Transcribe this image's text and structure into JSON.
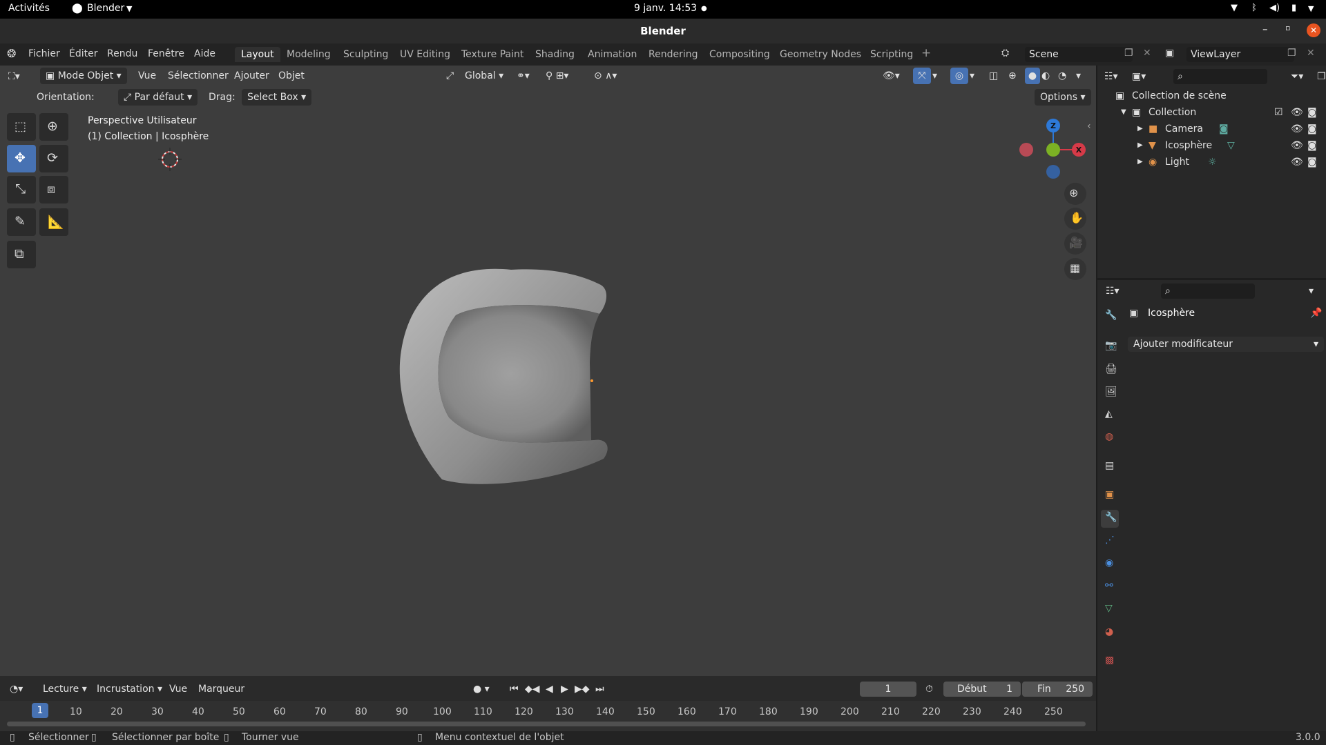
{
  "system": {
    "activities": "Activités",
    "app_menu": "Blender",
    "clock": "9 janv.  14:53"
  },
  "window": {
    "title": "Blender"
  },
  "menu": {
    "items": [
      "Fichier",
      "Éditer",
      "Rendu",
      "Fenêtre",
      "Aide"
    ]
  },
  "workspaces": {
    "tabs": [
      "Layout",
      "Modeling",
      "Sculpting",
      "UV Editing",
      "Texture Paint",
      "Shading",
      "Animation",
      "Rendering",
      "Compositing",
      "Geometry Nodes",
      "Scripting"
    ],
    "active": "Layout"
  },
  "scene": {
    "name": "Scene"
  },
  "view_layer": {
    "name": "ViewLayer"
  },
  "viewport_header": {
    "mode": "Mode Objet",
    "menus": [
      "Vue",
      "Sélectionner",
      "Ajouter",
      "Objet"
    ],
    "transform_orientation": "Global"
  },
  "tool_header": {
    "orientation_label": "Orientation:",
    "orientation_value": "Par défaut",
    "drag_label": "Drag:",
    "drag_value": "Select Box",
    "options_label": "Options"
  },
  "viewport": {
    "perspective_label": "Perspective Utilisateur",
    "collection_label": "(1) Collection | Icosphère",
    "object_color": "#8a8a8a",
    "background_color": "#3d3d3d"
  },
  "gizmo": {
    "x_label": "X",
    "y_label": "Y",
    "z_label": "Z",
    "x_color": "#d63a48",
    "y_color": "#7cb124",
    "z_color": "#2d79d8"
  },
  "outliner": {
    "scene_collection": "Collection de scène",
    "items": [
      {
        "name": "Collection",
        "level": 1
      },
      {
        "name": "Camera",
        "level": 2
      },
      {
        "name": "Icosphère",
        "level": 2
      },
      {
        "name": "Light",
        "level": 2
      }
    ]
  },
  "properties": {
    "object_name": "Icosphère",
    "add_modifier": "Ajouter modificateur"
  },
  "timeline": {
    "menus": [
      "Lecture",
      "Incrustation",
      "Vue",
      "Marqueur"
    ],
    "current_frame": "1",
    "start_label": "Début",
    "start_value": "1",
    "end_label": "Fin",
    "end_value": "250",
    "ruler": [
      "1",
      "10",
      "20",
      "30",
      "40",
      "50",
      "60",
      "70",
      "80",
      "90",
      "100",
      "110",
      "120",
      "130",
      "140",
      "150",
      "160",
      "170",
      "180",
      "190",
      "200",
      "210",
      "220",
      "230",
      "240",
      "250"
    ]
  },
  "status_bar": {
    "select": "Sélectionner",
    "box_select": "Sélectionner par boîte",
    "rotate_view": "Tourner vue",
    "context_menu": "Menu contextuel de l'objet",
    "version": "3.0.0"
  }
}
